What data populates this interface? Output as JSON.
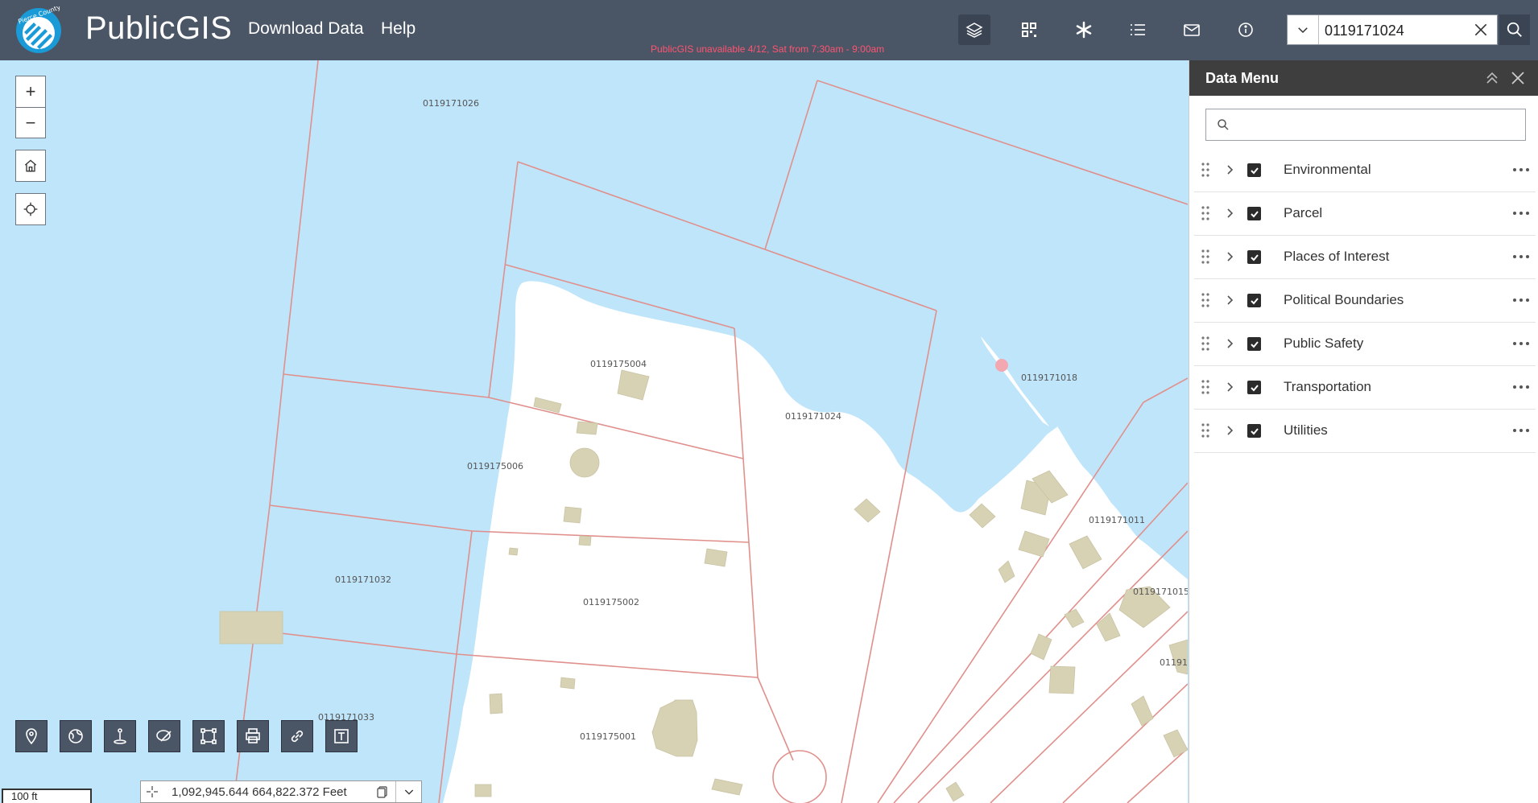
{
  "header": {
    "title": "PublicGIS",
    "nav": [
      "Download Data",
      "Help"
    ],
    "notice": "PublicGIS unavailable 4/12, Sat from 7:30am - 9:00am",
    "toolbar_icons": [
      "layers-icon",
      "qr-grid-icon",
      "asterisk-icon",
      "list-icon",
      "mail-icon",
      "info-icon"
    ],
    "logo_text": "Pierce County"
  },
  "search": {
    "value": "0119171024"
  },
  "map": {
    "parcels": [
      "0119171026",
      "0119175004",
      "0119171024",
      "0119171018",
      "0119175006",
      "0119171011",
      "0119171015",
      "0119171032",
      "0119175002",
      "0119171033",
      "0119175001",
      "011917"
    ],
    "zoom_in": "+",
    "zoom_out": "−",
    "scale": "100 ft",
    "coordinates": "1,092,945.644 664,822.372 Feet"
  },
  "colors": {
    "water": "#bfe5fa",
    "parcel_line": "#e0908c",
    "building": "#d7d2b4",
    "header": "#4a5566"
  },
  "panel": {
    "title": "Data Menu",
    "search_placeholder": "",
    "layers": [
      {
        "label": "Environmental",
        "checked": true
      },
      {
        "label": "Parcel",
        "checked": true
      },
      {
        "label": "Places of Interest",
        "checked": true
      },
      {
        "label": "Political Boundaries",
        "checked": true
      },
      {
        "label": "Public Safety",
        "checked": true
      },
      {
        "label": "Transportation",
        "checked": true
      },
      {
        "label": "Utilities",
        "checked": true
      }
    ]
  },
  "bottom_tools": [
    "location-pin-icon",
    "globe-icon",
    "person-pin-icon",
    "draw-icon",
    "select-area-icon",
    "print-icon",
    "link-icon",
    "text-icon"
  ]
}
